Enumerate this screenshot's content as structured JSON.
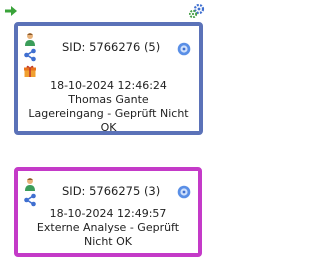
{
  "colors": {
    "card1_border": "#5b72b8",
    "card2_border": "#c43ac8",
    "arrow": "#3aa33a",
    "gear": "#3f6fd0"
  },
  "toolbar": {
    "arrow_icon": "arrow-right-icon",
    "settings_icon": "gears-icon"
  },
  "cards": [
    {
      "sid_text": "SID: 5766276 (5)",
      "datetime": "18-10-2024 12:46:24",
      "person": "Thomas Gante",
      "status": "Lagereingang - Geprüft Nicht OK",
      "icons": [
        "user-icon",
        "share-icon",
        "gift-box-icon",
        "disc-icon"
      ]
    },
    {
      "sid_text": "SID: 5766275 (3)",
      "datetime": "18-10-2024 12:49:57",
      "status": "Externe Analyse - Geprüft Nicht OK",
      "icons": [
        "user-icon",
        "share-icon",
        "disc-icon"
      ]
    }
  ]
}
